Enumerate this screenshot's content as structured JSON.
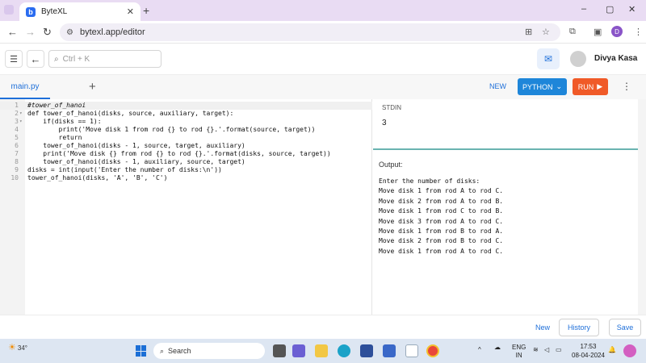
{
  "browser": {
    "tab_title": "ByteXL",
    "tab_favicon": "b",
    "url": "bytexl.app/editor",
    "profile_initial": "D",
    "minimize": "–",
    "maximize": "▢",
    "close": "✕"
  },
  "header": {
    "search_placeholder": "Ctrl + K",
    "user_name": "Divya Kasa"
  },
  "editor": {
    "file_tab": "main.py",
    "new_label": "NEW",
    "language_label": "PYTHON",
    "run_label": "RUN",
    "code_lines": [
      "#tower_of_hanoi",
      "def tower_of_hanoi(disks, source, auxiliary, target):",
      "    if(disks == 1):",
      "        print('Move disk 1 from rod {} to rod {}.'.format(source, target))",
      "        return",
      "    tower_of_hanoi(disks - 1, source, target, auxiliary)",
      "    print('Move disk {} from rod {} to rod {}.'.format(disks, source, target))",
      "    tower_of_hanoi(disks - 1, auxiliary, source, target)",
      "disks = int(input('Enter the number of disks:\\n'))",
      "tower_of_hanoi(disks, 'A', 'B', 'C')"
    ]
  },
  "stdin": {
    "label": "STDIN",
    "value": "3"
  },
  "output": {
    "label": "Output:",
    "lines": [
      "Enter the number of disks:",
      "Move disk 1 from rod A to rod C.",
      "Move disk 2 from rod A to rod B.",
      "Move disk 1 from rod C to rod B.",
      "Move disk 3 from rod A to rod C.",
      "Move disk 1 from rod B to rod A.",
      "Move disk 2 from rod B to rod C.",
      "Move disk 1 from rod A to rod C."
    ]
  },
  "footer": {
    "new_label": "New",
    "history_label": "History",
    "save_label": "Save"
  },
  "taskbar": {
    "temperature": "34°",
    "search_label": "Search",
    "language": "ENG",
    "region": "IN",
    "time": "17:53",
    "date": "08-04-2024"
  },
  "colors": {
    "accent": "#1e6fd9",
    "python_button": "#1e86d9",
    "run_button": "#f05a28",
    "stdin_border": "#6ab3b0"
  }
}
